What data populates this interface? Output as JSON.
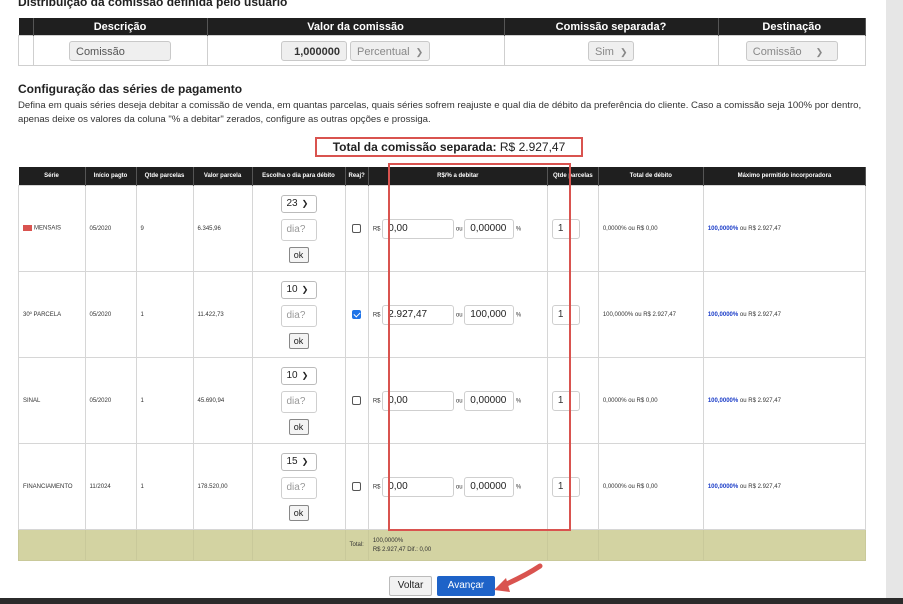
{
  "section1": {
    "title": "Distribuição da comissão definida pelo usuário",
    "headers": [
      "Descrição",
      "Valor da comissão",
      "Comissão separada?",
      "Destinação"
    ],
    "row": {
      "descricao": "Comissão",
      "valor": "1,000000",
      "tipo": "Percentual",
      "separada": "Sim",
      "destinacao": "Comissão"
    }
  },
  "section2": {
    "title": "Configuração das séries de pagamento",
    "description": "Defina em quais séries deseja debitar a comissão de venda, em quantas parcelas, quais séries sofrem reajuste e qual dia de débito da preferência do cliente. Caso a comissão seja 100% por dentro, apenas deixe os valores da coluna \"% a debitar\" zerados, configure as outras opções e prossiga.",
    "total_label": "Total da comissão separada:",
    "total_value": "R$ 2.927,47"
  },
  "series_table": {
    "headers": [
      "Série",
      "Início pagto",
      "Qtde parcelas",
      "Valor parcela",
      "Escolha o dia para débito",
      "Reaj?",
      "R$/% a debitar",
      "Qtde parcelas",
      "Total de débito",
      "Máximo permitido incorporadora"
    ],
    "placeholder_dia": "dia?",
    "ok_label": "ok",
    "rs_label": "R$",
    "ou_label": "ou",
    "pct_label": "%",
    "rows": [
      {
        "serie": "MENSAIS",
        "inicio": "05/2020",
        "qtde": "9",
        "valor": "6.345,96",
        "dia": "23",
        "reaj": false,
        "rs": "0,00",
        "pct": "0,00000",
        "parcelas": "1",
        "total": "0,0000% ou R$ 0,00",
        "max_pct": "100,0000%",
        "max_val": "ou R$ 2.927,47"
      },
      {
        "serie": "30º PARCELA",
        "inicio": "05/2020",
        "qtde": "1",
        "valor": "11.422,73",
        "dia": "10",
        "reaj": true,
        "rs": "2.927,47",
        "pct": "100,000",
        "parcelas": "1",
        "total": "100,0000% ou R$ 2.927,47",
        "max_pct": "100,0000%",
        "max_val": "ou R$ 2.927,47"
      },
      {
        "serie": "SINAL",
        "inicio": "05/2020",
        "qtde": "1",
        "valor": "45.690,94",
        "dia": "10",
        "reaj": false,
        "rs": "0,00",
        "pct": "0,00000",
        "parcelas": "1",
        "total": "0,0000% ou R$ 0,00",
        "max_pct": "100,0000%",
        "max_val": "ou R$ 2.927,47"
      },
      {
        "serie": "FINANCIAMENTO",
        "inicio": "11/2024",
        "qtde": "1",
        "valor": "178.520,00",
        "dia": "15",
        "reaj": false,
        "rs": "0,00",
        "pct": "0,00000",
        "parcelas": "1",
        "total": "0,0000% ou R$ 0,00",
        "max_pct": "100,0000%",
        "max_val": "ou R$ 2.927,47"
      }
    ],
    "footer": {
      "label": "Total:",
      "pct": "100,0000%",
      "detail": "R$ 2.927,47 Dif.: 0,00"
    }
  },
  "buttons": {
    "voltar": "Voltar",
    "avancar": "Avançar"
  },
  "colors": {
    "header_bg": "#1f1f1f",
    "highlight": "#d9534f",
    "primary": "#1e63c8",
    "footer_bg": "#d3d3a2"
  }
}
